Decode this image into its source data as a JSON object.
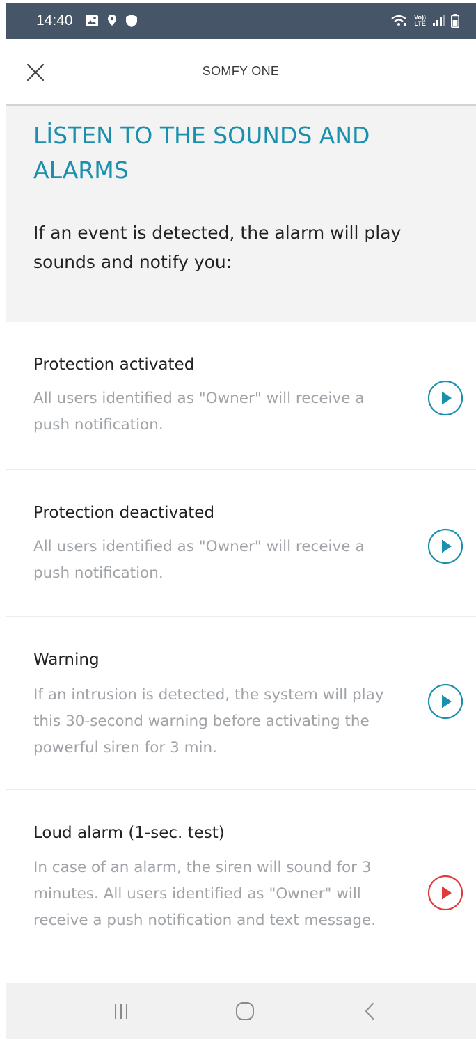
{
  "status_bar": {
    "time": "14:40",
    "left_icons": [
      "gallery-icon",
      "location-icon",
      "shield-icon"
    ],
    "right_icons": [
      "wifi-calling-icon",
      "volte-icon",
      "signal-icon",
      "battery-icon"
    ],
    "volte_top": "Vo))",
    "volte_bottom": "LTE",
    "background_color": "#465668"
  },
  "header": {
    "title": "SOMFY ONE",
    "close_icon": "close-icon"
  },
  "intro": {
    "title": "LİSTEN TO THE SOUNDS AND ALARMS",
    "description": "If an event is detected, the alarm will play sounds and notify you:",
    "title_color": "#1b90ad",
    "background_color": "#f3f3f4"
  },
  "sounds": [
    {
      "title": "Protection activated",
      "description": "All users identified as \"Owner\" will receive a push notification.",
      "icon": "play-icon",
      "color": "#1b90ad"
    },
    {
      "title": "Protection deactivated",
      "description": "All users identified as \"Owner\" will receive a push notification.",
      "icon": "play-icon",
      "color": "#1b90ad"
    },
    {
      "title": "Warning",
      "description": "If an intrusion is detected, the system will play this 30-second warning before activating the powerful siren for 3 min.",
      "icon": "play-icon",
      "color": "#1b90ad"
    },
    {
      "title": "Loud alarm (1-sec. test)",
      "description": "In case of an alarm, the siren will sound for 3 minutes. All users identified as \"Owner\" will receive a push notification and text message.",
      "icon": "play-icon",
      "color": "#e03a3a"
    }
  ],
  "nav_bar": {
    "buttons": [
      "recent-apps-icon",
      "home-icon",
      "back-icon"
    ]
  }
}
